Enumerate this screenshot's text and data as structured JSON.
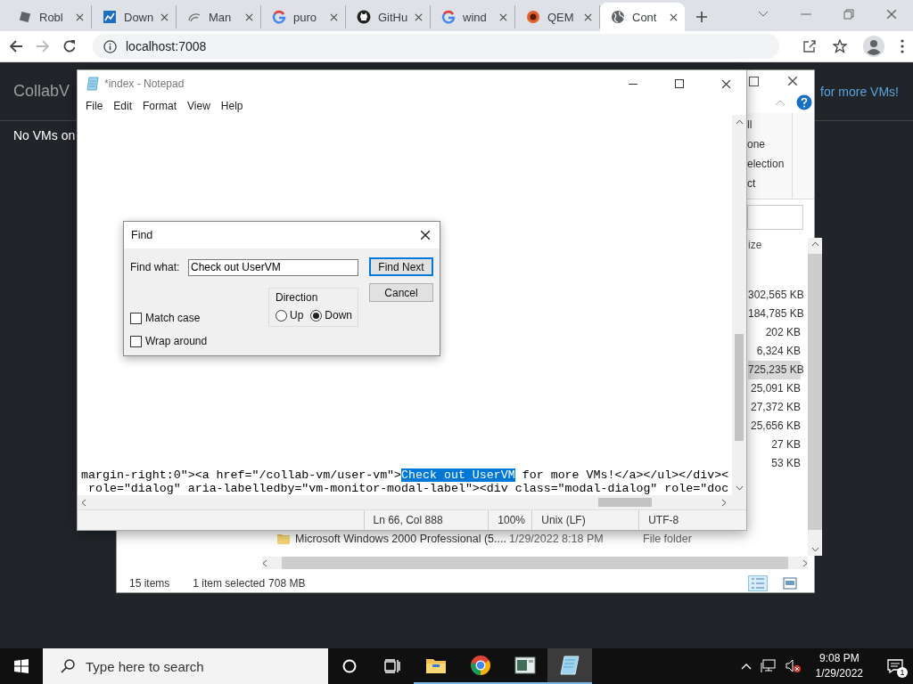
{
  "browser": {
    "tabs": [
      {
        "label": "Robl",
        "kind": "tilted-square",
        "selected": false
      },
      {
        "label": "Down",
        "kind": "chart",
        "selected": false
      },
      {
        "label": "Man",
        "kind": "arc",
        "selected": false
      },
      {
        "label": "puro",
        "kind": "g",
        "selected": false
      },
      {
        "label": "GitHu",
        "kind": "cat",
        "selected": false
      },
      {
        "label": "wind",
        "kind": "g",
        "selected": false
      },
      {
        "label": "QEM",
        "kind": "ball",
        "selected": false
      },
      {
        "label": "Cont",
        "kind": "globe",
        "selected": true
      }
    ],
    "forward_disabled": true,
    "address": "localhost:7008"
  },
  "page": {
    "brand": "CollabV",
    "link": "for more VMs!",
    "message": "No VMs on"
  },
  "explorer": {
    "ribbon_items": [
      "ll",
      "one",
      "election",
      "ct"
    ],
    "column_header": "ize",
    "sizes": [
      {
        "size": "302,565 KB",
        "selected": false
      },
      {
        "size": "184,785 KB",
        "selected": false
      },
      {
        "size": "202 KB",
        "selected": false
      },
      {
        "size": "6,324 KB",
        "selected": false
      },
      {
        "size": "725,235 KB",
        "selected": true
      },
      {
        "size": "25,091 KB",
        "selected": false
      },
      {
        "size": "27,372 KB",
        "selected": false
      },
      {
        "size": "25,656 KB",
        "selected": false
      },
      {
        "size": "27 KB",
        "selected": false
      },
      {
        "size": "53 KB",
        "selected": false
      }
    ],
    "folder_row": {
      "name": "Microsoft Windows 2000 Professional (5....",
      "date": "1/29/2022 8:18 PM",
      "type": "File folder"
    },
    "status": {
      "items": "15 items",
      "selection": "1 item selected",
      "size": "708 MB"
    }
  },
  "notepad": {
    "title": "*index - Notepad",
    "menu": [
      "File",
      "Edit",
      "Format",
      "View",
      "Help"
    ],
    "lines": [
      [
        {
          "text": "margin-right:0\"><a href=\"/collab-vm/user-vm\">",
          "selected": false
        },
        {
          "text": "Check out UserVM",
          "selected": true
        },
        {
          "text": " for more VMs!</a></ul></div><",
          "selected": false
        }
      ],
      [
        {
          "text": " role=\"dialog\" aria-labelledby=\"vm-monitor-modal-label\"><div class=\"modal-dialog\" role=\"doc",
          "selected": false
        }
      ]
    ],
    "status": [
      "Ln 66, Col 888",
      "100%",
      "Unix (LF)",
      "UTF-8"
    ]
  },
  "find_dialog": {
    "title": "Find",
    "label": "Find what:",
    "value": "Check out UserVM",
    "direction_label": "Direction",
    "directions": [
      {
        "label": "Up",
        "selected": false
      },
      {
        "label": "Down",
        "selected": true
      }
    ],
    "options": [
      {
        "label": "Match case",
        "checked": false
      },
      {
        "label": "Wrap around",
        "checked": false
      }
    ],
    "buttons": [
      {
        "label": "Find Next",
        "default": true
      },
      {
        "label": "Cancel",
        "default": false
      }
    ]
  },
  "taskbar": {
    "search_placeholder": "Type here to search",
    "apps": [
      {
        "kind": "folder",
        "selected": false
      },
      {
        "kind": "chrome",
        "selected": false
      },
      {
        "kind": "board",
        "selected": false
      },
      {
        "kind": "notepad",
        "selected": true
      }
    ],
    "time": "9:08 PM",
    "date": "1/29/2022",
    "notification_count": "1"
  }
}
